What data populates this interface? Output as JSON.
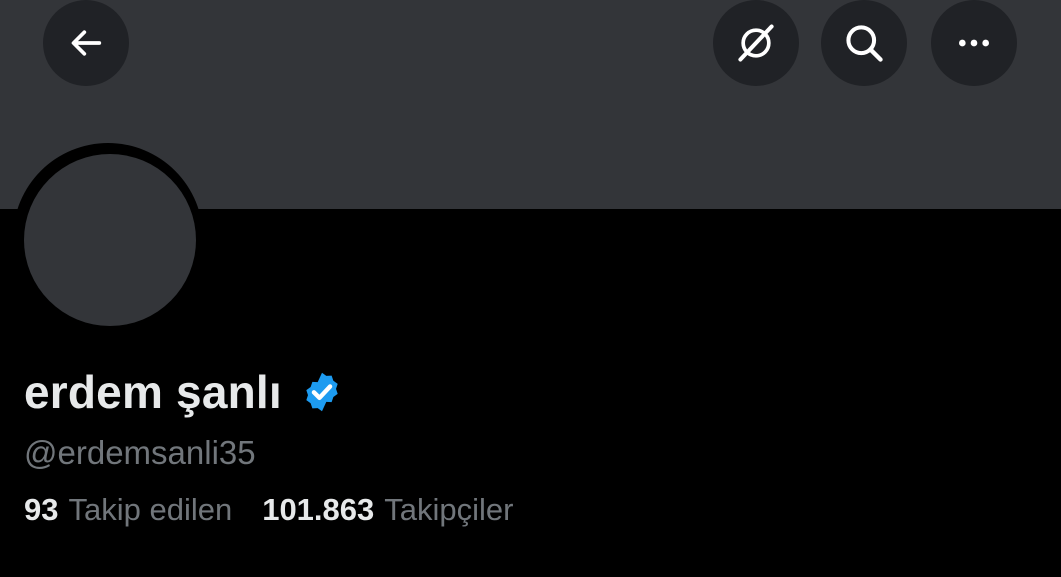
{
  "profile": {
    "display_name": "erdem şanlı",
    "handle": "@erdemsanli35",
    "verified": true
  },
  "stats": {
    "following_count": "93",
    "following_label": "Takip edilen",
    "followers_count": "101.863",
    "followers_label": "Takipçiler"
  },
  "icons": {
    "back": "arrow-left-icon",
    "grok": "grok-icon",
    "search": "search-icon",
    "more": "more-dots-icon",
    "verified": "verified-badge-icon"
  },
  "colors": {
    "background": "#000000",
    "banner": "#333539",
    "button_bg": "#202226",
    "primary_text": "#e7e9ea",
    "secondary_text": "#71767b",
    "verified_blue": "#1d9bf0"
  }
}
